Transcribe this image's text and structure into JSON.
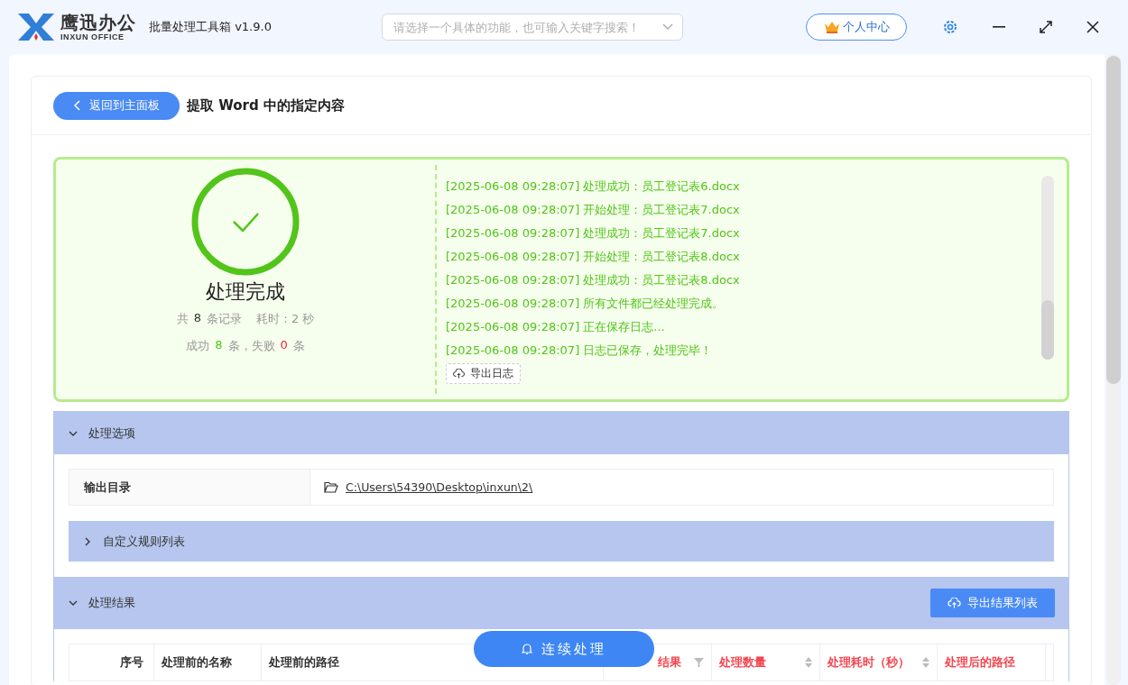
{
  "app": {
    "brand": "鹰迅办公",
    "brand_sub": "INXUN OFFICE",
    "title": "批量处理工具箱 v1.9.0",
    "search": {
      "placeholder": "请选择一个具体的功能，也可输入关键字搜索！"
    },
    "account_button": "个人中心"
  },
  "page": {
    "back_button": "返回到主面板",
    "title": "提取 Word 中的指定内容"
  },
  "result": {
    "status": "处理完成",
    "total_prefix": "共",
    "total": "8",
    "total_suffix": "条记录",
    "duration": "耗时：2 秒",
    "success_prefix": "成功",
    "success": "8",
    "success_suffix": "条，失败",
    "failed": "0",
    "failed_suffix": "条",
    "log": [
      "[2025-06-08 09:28:07] 处理成功：员工登记表6.docx",
      "[2025-06-08 09:28:07] 开始处理：员工登记表7.docx",
      "[2025-06-08 09:28:07] 处理成功：员工登记表7.docx",
      "[2025-06-08 09:28:07] 开始处理：员工登记表8.docx",
      "[2025-06-08 09:28:07] 处理成功：员工登记表8.docx",
      "[2025-06-08 09:28:07] 所有文件都已经处理完成。",
      "[2025-06-08 09:28:07] 正在保存日志...",
      "[2025-06-08 09:28:07] 日志已保存，处理完毕！"
    ],
    "export_log_button": "导出日志"
  },
  "options": {
    "title": "处理选项",
    "expanded": true,
    "output_label": "输出目录",
    "output_path": "C:\\Users\\54390\\Desktop\\inxun\\2\\",
    "rules": {
      "title": "自定义规则列表",
      "expanded": false
    }
  },
  "results": {
    "title": "处理结果",
    "expanded": true,
    "export_button": "导出结果列表",
    "columns": [
      {
        "kind": "blank"
      },
      {
        "label": "序号",
        "kind": "plain",
        "highlight": false
      },
      {
        "label": "处理前的名称",
        "kind": "plain",
        "highlight": false
      },
      {
        "label": "处理前的路径",
        "kind": "plain",
        "highlight": false
      },
      {
        "label": "结果",
        "kind": "filter",
        "highlight": true
      },
      {
        "label": "处理数量",
        "kind": "sort",
        "highlight": true
      },
      {
        "label": "处理耗时（秒）",
        "kind": "sort",
        "highlight": true
      },
      {
        "label": "处理后的路径",
        "kind": "plain",
        "highlight": true
      }
    ]
  },
  "continue_button": "连续处理"
}
